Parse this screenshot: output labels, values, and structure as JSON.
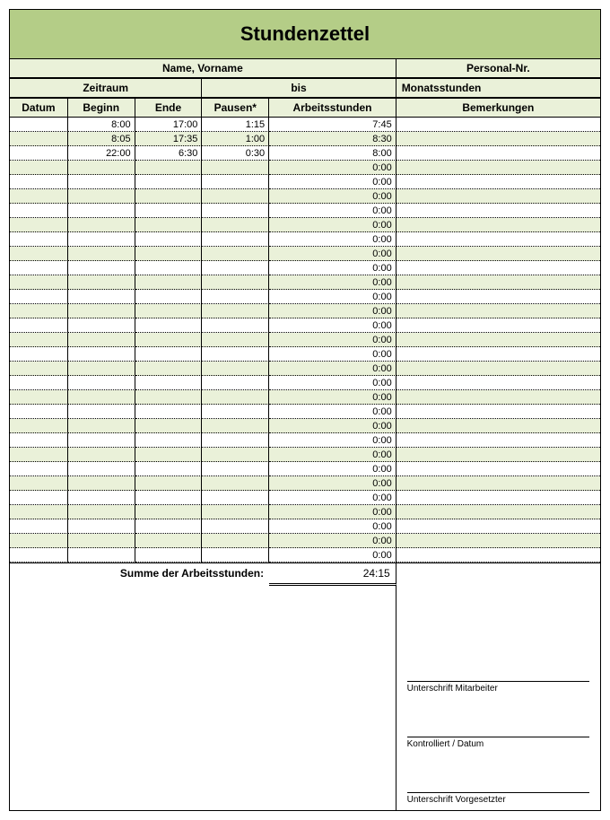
{
  "title": "Stundenzettel",
  "header": {
    "name_label": "Name, Vorname",
    "personalnr_label": "Personal-Nr.",
    "zeitraum_label": "Zeitraum",
    "bis_label": "bis",
    "monatsstunden_label": "Monatsstunden"
  },
  "columns": {
    "datum": "Datum",
    "beginn": "Beginn",
    "ende": "Ende",
    "pausen": "Pausen*",
    "arbeitsstunden": "Arbeitsstunden",
    "bemerkungen": "Bemerkungen"
  },
  "rows": [
    {
      "datum": "",
      "beginn": "8:00",
      "ende": "17:00",
      "pausen": "1:15",
      "arbeitsstunden": "7:45",
      "bemerkungen": ""
    },
    {
      "datum": "",
      "beginn": "8:05",
      "ende": "17:35",
      "pausen": "1:00",
      "arbeitsstunden": "8:30",
      "bemerkungen": ""
    },
    {
      "datum": "",
      "beginn": "22:00",
      "ende": "6:30",
      "pausen": "0:30",
      "arbeitsstunden": "8:00",
      "bemerkungen": ""
    },
    {
      "datum": "",
      "beginn": "",
      "ende": "",
      "pausen": "",
      "arbeitsstunden": "0:00",
      "bemerkungen": ""
    },
    {
      "datum": "",
      "beginn": "",
      "ende": "",
      "pausen": "",
      "arbeitsstunden": "0:00",
      "bemerkungen": ""
    },
    {
      "datum": "",
      "beginn": "",
      "ende": "",
      "pausen": "",
      "arbeitsstunden": "0:00",
      "bemerkungen": ""
    },
    {
      "datum": "",
      "beginn": "",
      "ende": "",
      "pausen": "",
      "arbeitsstunden": "0:00",
      "bemerkungen": ""
    },
    {
      "datum": "",
      "beginn": "",
      "ende": "",
      "pausen": "",
      "arbeitsstunden": "0:00",
      "bemerkungen": ""
    },
    {
      "datum": "",
      "beginn": "",
      "ende": "",
      "pausen": "",
      "arbeitsstunden": "0:00",
      "bemerkungen": ""
    },
    {
      "datum": "",
      "beginn": "",
      "ende": "",
      "pausen": "",
      "arbeitsstunden": "0:00",
      "bemerkungen": ""
    },
    {
      "datum": "",
      "beginn": "",
      "ende": "",
      "pausen": "",
      "arbeitsstunden": "0:00",
      "bemerkungen": ""
    },
    {
      "datum": "",
      "beginn": "",
      "ende": "",
      "pausen": "",
      "arbeitsstunden": "0:00",
      "bemerkungen": ""
    },
    {
      "datum": "",
      "beginn": "",
      "ende": "",
      "pausen": "",
      "arbeitsstunden": "0:00",
      "bemerkungen": ""
    },
    {
      "datum": "",
      "beginn": "",
      "ende": "",
      "pausen": "",
      "arbeitsstunden": "0:00",
      "bemerkungen": ""
    },
    {
      "datum": "",
      "beginn": "",
      "ende": "",
      "pausen": "",
      "arbeitsstunden": "0:00",
      "bemerkungen": ""
    },
    {
      "datum": "",
      "beginn": "",
      "ende": "",
      "pausen": "",
      "arbeitsstunden": "0:00",
      "bemerkungen": ""
    },
    {
      "datum": "",
      "beginn": "",
      "ende": "",
      "pausen": "",
      "arbeitsstunden": "0:00",
      "bemerkungen": ""
    },
    {
      "datum": "",
      "beginn": "",
      "ende": "",
      "pausen": "",
      "arbeitsstunden": "0:00",
      "bemerkungen": ""
    },
    {
      "datum": "",
      "beginn": "",
      "ende": "",
      "pausen": "",
      "arbeitsstunden": "0:00",
      "bemerkungen": ""
    },
    {
      "datum": "",
      "beginn": "",
      "ende": "",
      "pausen": "",
      "arbeitsstunden": "0:00",
      "bemerkungen": ""
    },
    {
      "datum": "",
      "beginn": "",
      "ende": "",
      "pausen": "",
      "arbeitsstunden": "0:00",
      "bemerkungen": ""
    },
    {
      "datum": "",
      "beginn": "",
      "ende": "",
      "pausen": "",
      "arbeitsstunden": "0:00",
      "bemerkungen": ""
    },
    {
      "datum": "",
      "beginn": "",
      "ende": "",
      "pausen": "",
      "arbeitsstunden": "0:00",
      "bemerkungen": ""
    },
    {
      "datum": "",
      "beginn": "",
      "ende": "",
      "pausen": "",
      "arbeitsstunden": "0:00",
      "bemerkungen": ""
    },
    {
      "datum": "",
      "beginn": "",
      "ende": "",
      "pausen": "",
      "arbeitsstunden": "0:00",
      "bemerkungen": ""
    },
    {
      "datum": "",
      "beginn": "",
      "ende": "",
      "pausen": "",
      "arbeitsstunden": "0:00",
      "bemerkungen": ""
    },
    {
      "datum": "",
      "beginn": "",
      "ende": "",
      "pausen": "",
      "arbeitsstunden": "0:00",
      "bemerkungen": ""
    },
    {
      "datum": "",
      "beginn": "",
      "ende": "",
      "pausen": "",
      "arbeitsstunden": "0:00",
      "bemerkungen": ""
    },
    {
      "datum": "",
      "beginn": "",
      "ende": "",
      "pausen": "",
      "arbeitsstunden": "0:00",
      "bemerkungen": ""
    },
    {
      "datum": "",
      "beginn": "",
      "ende": "",
      "pausen": "",
      "arbeitsstunden": "0:00",
      "bemerkungen": ""
    },
    {
      "datum": "",
      "beginn": "",
      "ende": "",
      "pausen": "",
      "arbeitsstunden": "0:00",
      "bemerkungen": ""
    }
  ],
  "sum": {
    "label": "Summe der Arbeitsstunden:",
    "value": "24:15"
  },
  "signatures": {
    "mitarbeiter": "Unterschrift Mitarbeiter",
    "kontrolliert": "Kontrolliert / Datum",
    "vorgesetzter": "Unterschrift Vorgesetzter"
  }
}
